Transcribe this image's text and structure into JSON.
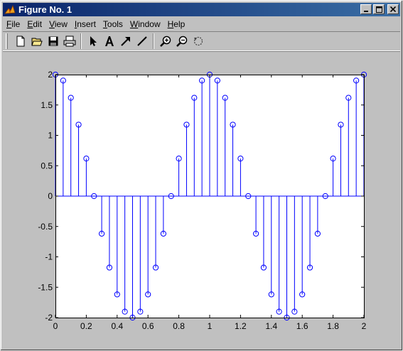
{
  "window": {
    "title": "Figure No. 1",
    "minimize_glyph": "_",
    "maximize_glyph": "□",
    "close_glyph": "✕"
  },
  "menu": [
    {
      "label": "File",
      "key": "F",
      "rest": "ile"
    },
    {
      "label": "Edit",
      "key": "E",
      "rest": "dit"
    },
    {
      "label": "View",
      "key": "V",
      "rest": "iew"
    },
    {
      "label": "Insert",
      "key": "I",
      "rest": "nsert"
    },
    {
      "label": "Tools",
      "key": "T",
      "rest": "ools"
    },
    {
      "label": "Window",
      "key": "W",
      "rest": "indow"
    },
    {
      "label": "Help",
      "key": "H",
      "rest": "elp"
    }
  ],
  "toolbar": [
    {
      "name": "new-figure",
      "icon": "new-file-icon"
    },
    {
      "name": "open-file",
      "icon": "folder-open-icon"
    },
    {
      "name": "save",
      "icon": "save-icon"
    },
    {
      "name": "print",
      "icon": "printer-icon"
    },
    {
      "name": "edit-plot",
      "icon": "arrow-pointer-icon"
    },
    {
      "name": "insert-text",
      "icon": "text-a-icon"
    },
    {
      "name": "insert-arrow",
      "icon": "arrow-icon"
    },
    {
      "name": "insert-line",
      "icon": "line-icon"
    },
    {
      "name": "zoom-in",
      "icon": "zoom-in-icon"
    },
    {
      "name": "zoom-out",
      "icon": "zoom-out-icon"
    },
    {
      "name": "rotate-3d",
      "icon": "rotate-icon"
    }
  ],
  "chart_data": {
    "type": "stem",
    "color": "#0000ff",
    "marker": "circle",
    "xlim": [
      0,
      2
    ],
    "ylim": [
      -2,
      2
    ],
    "xticks": [
      "0",
      "0.2",
      "0.4",
      "0.6",
      "0.8",
      "1",
      "1.2",
      "1.4",
      "1.6",
      "1.8",
      "2"
    ],
    "yticks": [
      "-2",
      "-1.5",
      "-1",
      "-0.5",
      "0",
      "0.5",
      "1",
      "1.5",
      "2"
    ],
    "x": [
      0,
      0.05,
      0.1,
      0.15,
      0.2,
      0.25,
      0.3,
      0.35,
      0.4,
      0.45,
      0.5,
      0.55,
      0.6,
      0.65,
      0.7,
      0.75,
      0.8,
      0.85,
      0.9,
      0.95,
      1,
      1.05,
      1.1,
      1.15,
      1.2,
      1.25,
      1.3,
      1.35,
      1.4,
      1.45,
      1.5,
      1.55,
      1.6,
      1.65,
      1.7,
      1.75,
      1.8,
      1.85,
      1.9,
      1.95,
      2
    ],
    "y": [
      2,
      1.902,
      1.618,
      1.176,
      0.618,
      0,
      -0.618,
      -1.176,
      -1.618,
      -1.902,
      -2,
      -1.902,
      -1.618,
      -1.176,
      -0.618,
      0,
      0.618,
      1.176,
      1.618,
      1.902,
      2,
      1.902,
      1.618,
      1.176,
      0.618,
      0,
      -0.618,
      -1.176,
      -1.618,
      -1.902,
      -2,
      -1.902,
      -1.618,
      -1.176,
      -0.618,
      0,
      0.618,
      1.176,
      1.618,
      1.902,
      2
    ]
  }
}
